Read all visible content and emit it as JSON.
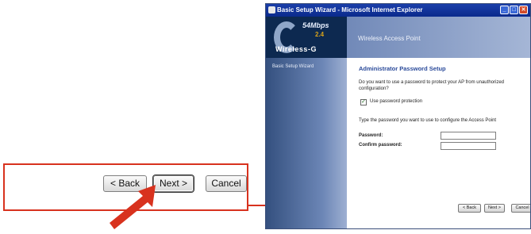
{
  "zoom": {
    "back_label": "< Back",
    "next_label": "Next >",
    "cancel_label": "Cancel"
  },
  "window": {
    "title": "Basic Setup Wizard - Microsoft Internet Explorer",
    "minimize": "_",
    "maximize": "□",
    "close": "✕",
    "logo": {
      "speed": "54Mbps",
      "band": "2.4",
      "product": "Wireless-G"
    },
    "header_title": "Wireless Access Point",
    "sidebar": {
      "items": [
        {
          "label": "Basic Setup Wizard"
        }
      ]
    },
    "content": {
      "section_title": "Administrator Password Setup",
      "question": "Do you want to use a password to protect your AP from unauthorized configuration?",
      "checkbox_checked": true,
      "checkbox_mark": "✓",
      "checkbox_label": "Use password protection",
      "instruction": "Type the password you want to use to configure the Access Point",
      "password_label": "Password:",
      "confirm_label": "Confirm password:",
      "password_value": "",
      "confirm_value": ""
    },
    "buttons": {
      "back": "< Back",
      "next": "Next >",
      "cancel": "Cancel"
    }
  },
  "colors": {
    "callout_red": "#d8321e",
    "titlebar_blue": "#0a2a8c",
    "heading_blue": "#2a4a9a"
  }
}
